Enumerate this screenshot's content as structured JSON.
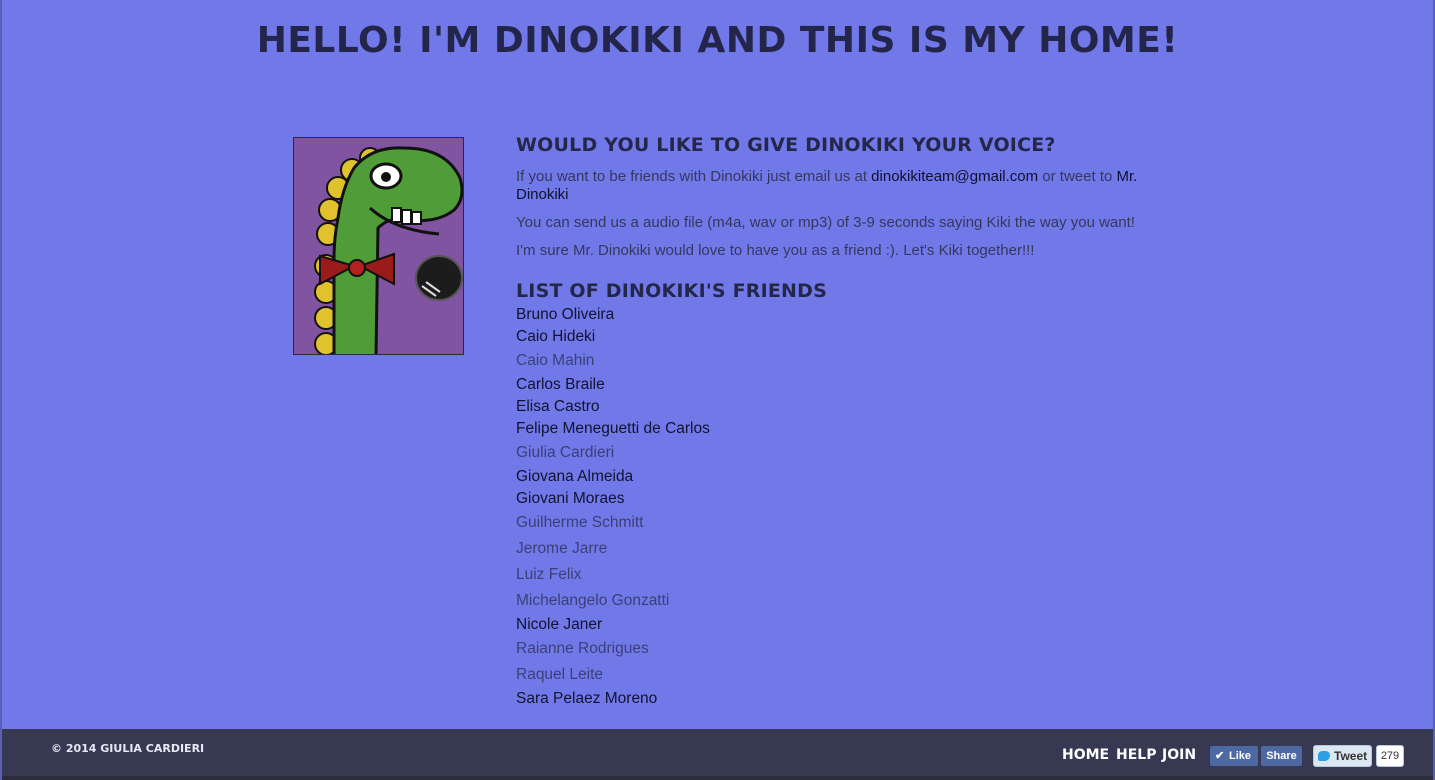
{
  "header": {
    "title": "HELLO! I'M DINOKIKI AND THIS IS MY HOME!"
  },
  "voice": {
    "heading": "WOULD YOU LIKE TO GIVE DINOKIKI YOUR VOICE?",
    "p1_before": "If you want to be friends with Dinokiki just email us at ",
    "email": "dinokikiteam@gmail.com",
    "p1_middle": " or tweet to ",
    "twitter_handle": "Mr. Dinokiki",
    "p2": "You can send us a audio file (m4a, wav or mp3) of 3-9 seconds saying Kiki the way you want!",
    "p3": "I'm sure Mr. Dinokiki would love to have you as a friend :). Let's Kiki together!!!"
  },
  "friends": {
    "heading": "LIST OF DINOKIKI'S FRIENDS",
    "names": [
      "Bruno Oliveira",
      "Caio Hideki",
      "Caio Mahin",
      "Carlos Braile",
      "Elisa Castro",
      "Felipe Meneguetti de Carlos",
      "Giulia Cardieri",
      "Giovana Almeida",
      "Giovani Moraes",
      "Guilherme Schmitt",
      "Jerome Jarre",
      "Luiz Felix",
      "Michelangelo Gonzatti",
      "Nicole Janer",
      "Raianne Rodrigues",
      "Raquel Leite",
      "Sara Pelaez Moreno"
    ]
  },
  "footer": {
    "copyright": "© 2014 GIULIA CARDIERI",
    "nav_home": "HOME",
    "nav_help": "HELP",
    "nav_join": "JOIN",
    "fb_like": "Like",
    "fb_share": "Share",
    "tweet": "Tweet",
    "tweet_count": "279"
  },
  "colors": {
    "background": "#7179e8",
    "footer": "#373852",
    "dino": "#4f9c38",
    "avatar_bg": "#8054a0"
  }
}
